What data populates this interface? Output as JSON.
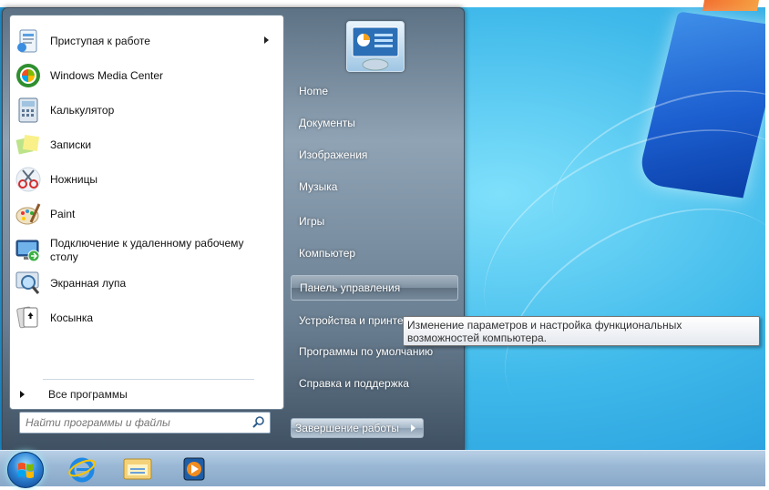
{
  "start_menu": {
    "programs": [
      {
        "label": "Приступая к работе",
        "icon": "getting-started-icon",
        "has_submenu": true
      },
      {
        "label": "Windows Media Center",
        "icon": "media-center-icon"
      },
      {
        "label": "Калькулятор",
        "icon": "calculator-icon"
      },
      {
        "label": "Записки",
        "icon": "sticky-notes-icon"
      },
      {
        "label": "Ножницы",
        "icon": "scissors-icon"
      },
      {
        "label": "Paint",
        "icon": "paint-icon"
      },
      {
        "label": "Подключение к удаленному рабочему столу",
        "icon": "remote-desktop-icon"
      },
      {
        "label": "Экранная лупа",
        "icon": "magnifier-icon"
      },
      {
        "label": "Косынка",
        "icon": "solitaire-icon"
      }
    ],
    "all_programs_label": "Все программы",
    "search_placeholder": "Найти программы и файлы",
    "places": [
      {
        "label": "Home"
      },
      {
        "label": "Документы"
      },
      {
        "label": "Изображения"
      },
      {
        "label": "Музыка"
      },
      {
        "label": "Игры"
      },
      {
        "label": "Компьютер"
      },
      {
        "label": "Панель управления",
        "highlighted": true
      },
      {
        "label": "Устройства и принте"
      },
      {
        "label": "Программы по умолчанию"
      },
      {
        "label": "Справка и поддержка"
      }
    ],
    "shutdown_label": "Завершение работы"
  },
  "tooltip": {
    "text": "Изменение параметров и настройка функциональных возможностей компьютера."
  },
  "taskbar": {
    "items": [
      {
        "icon": "start-orb-icon"
      },
      {
        "icon": "internet-explorer-icon"
      },
      {
        "icon": "windows-explorer-icon"
      },
      {
        "icon": "media-player-icon"
      }
    ]
  },
  "colors": {
    "menu_frame": "#6b8093",
    "left_pane": "#ffffff",
    "tooltip_border": "#767676",
    "desktop": "#3fb9ea"
  }
}
